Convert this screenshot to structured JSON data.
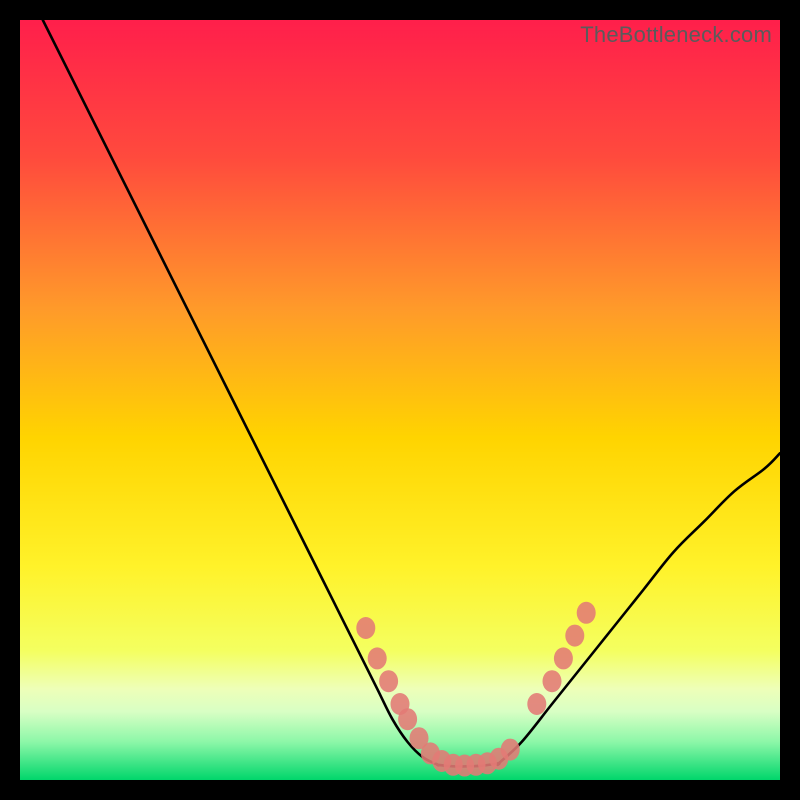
{
  "attribution": "TheBottleneck.com",
  "colors": {
    "gradient_top": "#ff1f4b",
    "gradient_mid1": "#ff7a2a",
    "gradient_mid2": "#ffd400",
    "gradient_mid3": "#f6ff3a",
    "gradient_bottom_band": "#e6ffb0",
    "gradient_bottom": "#00d66b",
    "curve": "#000000",
    "marker_fill": "#e37a75",
    "marker_stroke": "#c9514c",
    "frame": "#000000"
  },
  "chart_data": {
    "type": "line",
    "title": "",
    "xlabel": "",
    "ylabel": "",
    "xlim": [
      0,
      100
    ],
    "ylim": [
      0,
      100
    ],
    "series": [
      {
        "name": "curve-left",
        "x": [
          3,
          6,
          10,
          14,
          18,
          22,
          26,
          30,
          34,
          38,
          41,
          44,
          47,
          49,
          51,
          53,
          55
        ],
        "y": [
          100,
          94,
          86,
          78,
          70,
          62,
          54,
          46,
          38,
          30,
          24,
          18,
          12,
          8,
          5,
          3,
          2
        ]
      },
      {
        "name": "curve-bottom",
        "x": [
          55,
          57,
          59,
          61,
          63
        ],
        "y": [
          2,
          1.8,
          1.8,
          1.9,
          2.2
        ]
      },
      {
        "name": "curve-right",
        "x": [
          63,
          66,
          70,
          74,
          78,
          82,
          86,
          90,
          94,
          98,
          100
        ],
        "y": [
          2.2,
          5,
          10,
          15,
          20,
          25,
          30,
          34,
          38,
          41,
          43
        ]
      }
    ],
    "markers": [
      {
        "x": 45.5,
        "y": 20
      },
      {
        "x": 47.0,
        "y": 16
      },
      {
        "x": 48.5,
        "y": 13
      },
      {
        "x": 50.0,
        "y": 10
      },
      {
        "x": 51.0,
        "y": 8
      },
      {
        "x": 52.5,
        "y": 5.5
      },
      {
        "x": 54.0,
        "y": 3.5
      },
      {
        "x": 55.5,
        "y": 2.5
      },
      {
        "x": 57.0,
        "y": 2.0
      },
      {
        "x": 58.5,
        "y": 1.9
      },
      {
        "x": 60.0,
        "y": 2.0
      },
      {
        "x": 61.5,
        "y": 2.2
      },
      {
        "x": 63.0,
        "y": 2.8
      },
      {
        "x": 64.5,
        "y": 4.0
      },
      {
        "x": 68.0,
        "y": 10
      },
      {
        "x": 70.0,
        "y": 13
      },
      {
        "x": 71.5,
        "y": 16
      },
      {
        "x": 73.0,
        "y": 19
      },
      {
        "x": 74.5,
        "y": 22
      }
    ]
  }
}
